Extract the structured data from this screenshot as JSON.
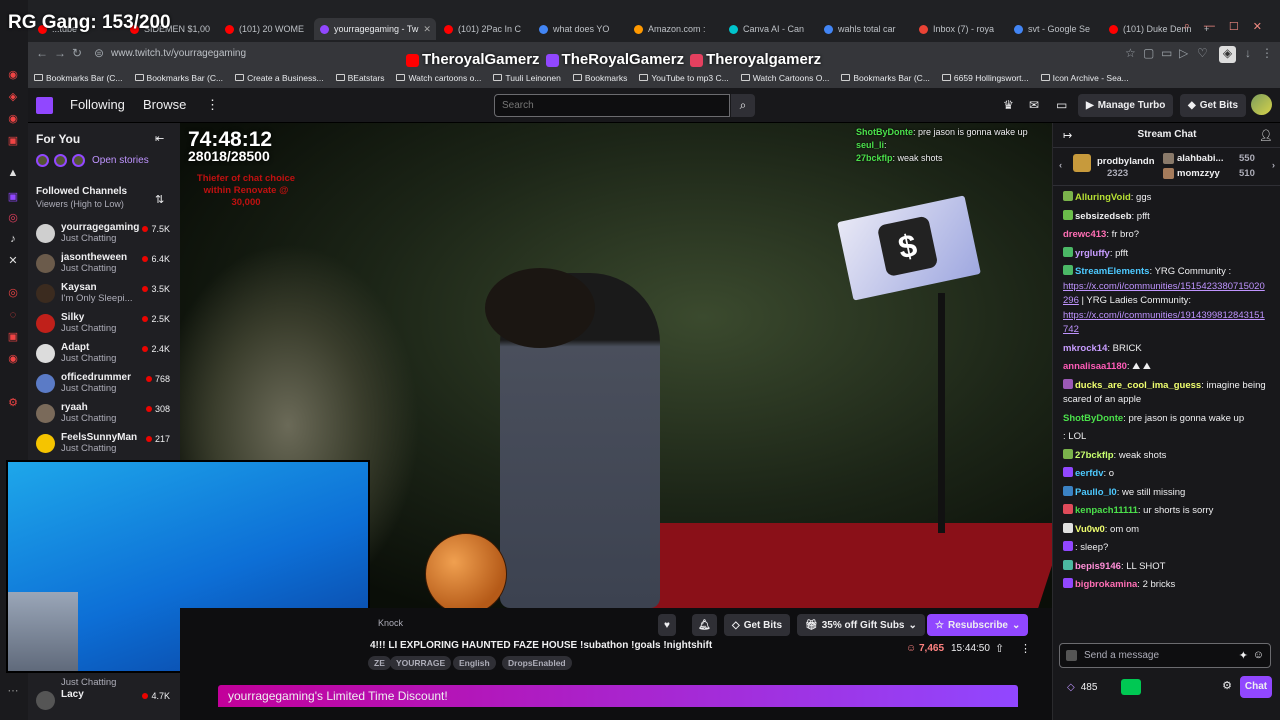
{
  "overlay": {
    "title": "RG Gang: 153/200",
    "socials": [
      "TheroyalGamerz",
      "TheRoyalGamerz",
      "Theroyalgamerz"
    ]
  },
  "browser": {
    "tabs": [
      {
        "label": "...tube",
        "color": "#ff0000"
      },
      {
        "label": "SIDEMEN $1,00",
        "color": "#ff0000"
      },
      {
        "label": "(101) 20 WOME",
        "color": "#ff0000"
      },
      {
        "label": "yourragegaming - Tw",
        "color": "#9147ff",
        "active": true
      },
      {
        "label": "(101) 2Pac In C",
        "color": "#ff0000"
      },
      {
        "label": "what does YO",
        "color": "#4285f4"
      },
      {
        "label": "Amazon.com :",
        "color": "#ff9900"
      },
      {
        "label": "Canva AI - Can",
        "color": "#00c4cc"
      },
      {
        "label": "wahls total car",
        "color": "#4285f4"
      },
      {
        "label": "Inbox (7) - roya",
        "color": "#ea4335"
      },
      {
        "label": "svt - Google Se",
        "color": "#4285f4"
      },
      {
        "label": "(101) Duke Denn",
        "color": "#ff0000"
      }
    ],
    "url": "www.twitch.tv/yourragegaming",
    "bookmarks": [
      "Bookmarks Bar (C...",
      "Bookmarks Bar (C...",
      "Create a Business...",
      "BEatstars",
      "Watch cartoons o...",
      "Tuuli Leinonen",
      "Bookmarks",
      "YouTube to mp3 C...",
      "Watch Cartoons O...",
      "Bookmarks Bar (C...",
      "6659 Hollingswort...",
      "Icon Archive - Sea..."
    ]
  },
  "twitch": {
    "nav": {
      "following": "Following",
      "browse": "Browse",
      "search_placeholder": "Search",
      "manage_turbo": "Manage Turbo",
      "get_bits": "Get Bits"
    },
    "sidebar": {
      "for_you": "For You",
      "open_stories": "Open stories",
      "followed_channels": "Followed Channels",
      "sort": "Viewers (High to Low)",
      "channels": [
        {
          "name": "yourragegaming",
          "game": "Just Chatting",
          "viewers": "7.5K",
          "color": "#cfcfcf"
        },
        {
          "name": "jasontheween",
          "game": "Just Chatting",
          "viewers": "6.4K",
          "color": "#6b5b4b"
        },
        {
          "name": "Kaysan",
          "game": "I'm Only Sleepi...",
          "viewers": "3.5K",
          "color": "#3b2b1f"
        },
        {
          "name": "Silky",
          "game": "Just Chatting",
          "viewers": "2.5K",
          "color": "#c0201a"
        },
        {
          "name": "Adapt",
          "game": "Just Chatting",
          "viewers": "2.4K",
          "color": "#dcdcdc"
        },
        {
          "name": "officedrummer",
          "game": "Just Chatting",
          "viewers": "768",
          "color": "#5b7bc6"
        },
        {
          "name": "ryaah",
          "game": "Just Chatting",
          "viewers": "308",
          "color": "#7a6a5a"
        },
        {
          "name": "FeelsSunnyMan",
          "game": "Just Chatting",
          "viewers": "217",
          "color": "#f5c400"
        }
      ],
      "lower": [
        {
          "name": "",
          "game": "Just Chatting",
          "viewers": ""
        },
        {
          "name": "Lacy",
          "game": "",
          "viewers": "4.7K"
        }
      ]
    },
    "player": {
      "timer": "74:48:12",
      "subs": "28018/28500",
      "red_text": "Thiefer of chat choice within Renovate @ 30,000",
      "overlay_chat": [
        {
          "user": "ShotByDonte",
          "text": "pre jason is gonna wake up",
          "color": "#4be04b"
        },
        {
          "user": "seul_li",
          "text": "",
          "color": "#4be04b"
        },
        {
          "user": "27bckflp",
          "text": "weak shots",
          "color": "#4be04b"
        }
      ]
    },
    "info": {
      "get_bits": "Get Bits",
      "gift": "35% off Gift Subs",
      "resub": "Resubscribe",
      "title": "4!!! LI EXPLORING HAUNTED FAZE HOUSE !subathon !goals !nightshift",
      "tags": [
        "ZE",
        "YOURRAGE",
        "English",
        "DropsEnabled"
      ],
      "viewers": "7,465",
      "uptime": "15:44:50",
      "knock": "Knock",
      "discount": "yourragegaming's Limited Time Discount!"
    },
    "chat": {
      "title": "Stream Chat",
      "leaders": [
        {
          "name": "prodbylandn",
          "count": "2323"
        },
        {
          "name": "alahbabi...",
          "count": "550"
        },
        {
          "name": "momzzyy",
          "count": "510"
        }
      ],
      "messages": [
        {
          "user": "AlluringVoid",
          "text": "ggs",
          "color": "#b6e034",
          "badge": "#7ab34b"
        },
        {
          "user": "sebsizedseb",
          "text": "pfft",
          "color": "#efeff1",
          "badge": "#6bbd4a"
        },
        {
          "user": "drewc413",
          "text": "fr bro?",
          "color": "#ff6fb5",
          "badge": ""
        },
        {
          "user": "yrgluffy",
          "text": "pfft",
          "color": "#c79cff",
          "badge": "#4bb866"
        },
        {
          "user": "StreamElements",
          "text": "YRG Community : ",
          "color": "#4dc9ff",
          "badge": "#4bb866",
          "link": "https://x.com/i/communities/1515423380715020296",
          "text2": " | YRG Ladies Community: ",
          "link2": "https://x.com/i/communities/1914399812843151742"
        },
        {
          "user": "mkrock14",
          "text": "BRICK",
          "color": "#c79cff",
          "badge": ""
        },
        {
          "user": "annalisaa1180",
          "text": "⛰ ⛰",
          "color": "#ff5cb8",
          "badge": ""
        },
        {
          "user": "ducks_are_cool_ima_guess",
          "text": "imagine being scared of an apple",
          "color": "#f0ff6f",
          "badge": "#9b59b6"
        },
        {
          "user": "ShotByDonte",
          "text": "pre jason is gonna wake up",
          "color": "#4be04b",
          "badge": ""
        },
        {
          "user": "",
          "text": "LOL",
          "color": "#2e5bff",
          "badge": ""
        },
        {
          "user": "27bckflp",
          "text": "weak shots",
          "color": "#c8ff6f",
          "badge": "#7ab34b"
        },
        {
          "user": "eerfdv",
          "text": "o",
          "color": "#4dc9ff",
          "badge": "#9147ff"
        },
        {
          "user": "Paullo_I0",
          "text": "we still missing",
          "color": "#4dc9ff",
          "badge": "#3b82c4"
        },
        {
          "user": "kenpach11111",
          "text": "ur shorts is sorry",
          "color": "#4be04b",
          "badge": "#e04b5a"
        },
        {
          "user": "Vu0w0",
          "text": "om om",
          "color": "#f0ff6f",
          "badge": "#e0e0e0"
        },
        {
          "user": "",
          "text": "sleep?",
          "color": "#f0ff6f",
          "badge": "#9147ff"
        },
        {
          "user": "bepis9146",
          "text": "LL SHOT",
          "color": "#ff8fd8",
          "badge": "#4bb8a0"
        },
        {
          "user": "bigbrokamina",
          "text": "2 bricks",
          "color": "#ff6fb5",
          "badge": "#9147ff"
        }
      ],
      "input_placeholder": "Send a message",
      "points": "485",
      "chat_button": "Chat"
    }
  }
}
